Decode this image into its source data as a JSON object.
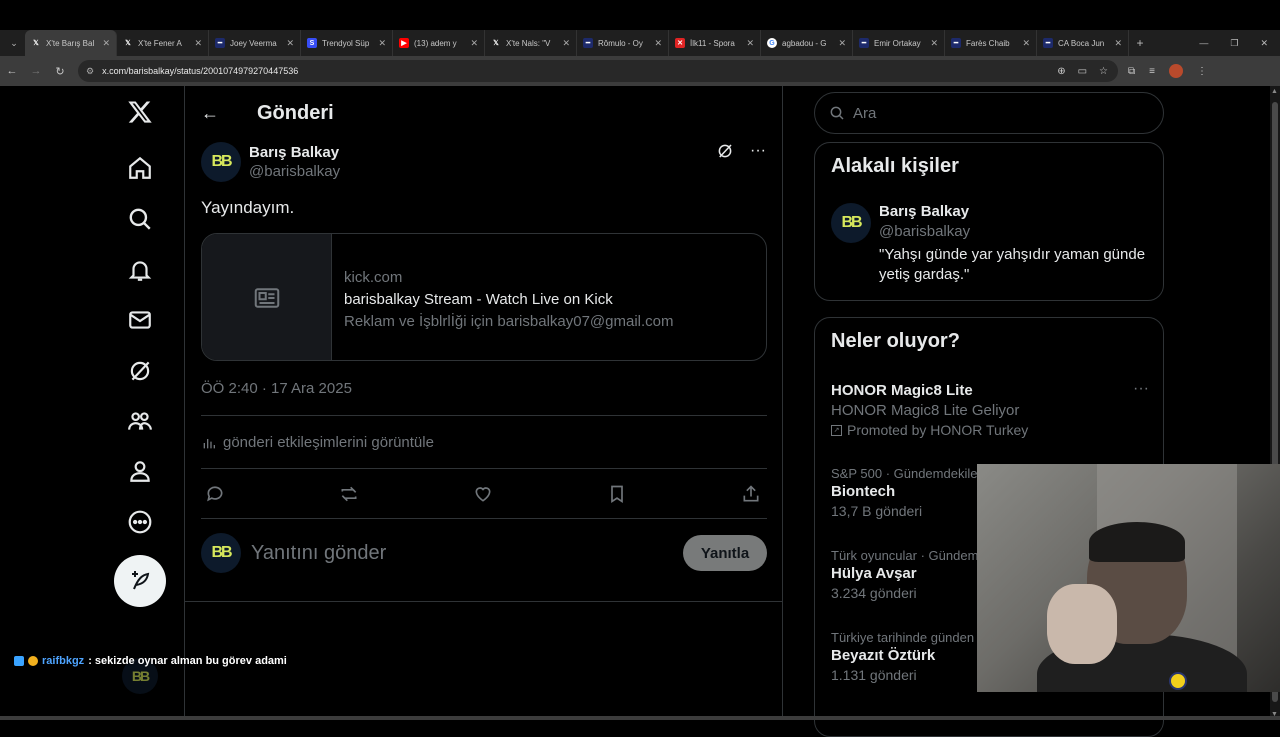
{
  "browser": {
    "tabs": [
      {
        "title": "X'te Barış Bal",
        "favicon": "x",
        "active": true
      },
      {
        "title": "X'te Fener A",
        "favicon": "x",
        "active": false
      },
      {
        "title": "Joey Veerma",
        "favicon": "fm",
        "active": false
      },
      {
        "title": "Trendyol Süp",
        "favicon": "sofa",
        "active": false
      },
      {
        "title": "(13) adem y",
        "favicon": "yt",
        "active": false
      },
      {
        "title": "X'te Nals: \"V",
        "favicon": "x",
        "active": false
      },
      {
        "title": "Rômulo - Oy",
        "favicon": "fm",
        "active": false
      },
      {
        "title": "İlk11 - Spora",
        "favicon": "ilk11",
        "active": false
      },
      {
        "title": "agbadou - G",
        "favicon": "google",
        "active": false
      },
      {
        "title": "Emir Ortakay",
        "favicon": "fm",
        "active": false
      },
      {
        "title": "Farès Chaib",
        "favicon": "fm",
        "active": false
      },
      {
        "title": "CA Boca Jun",
        "favicon": "fm",
        "active": false
      }
    ],
    "url": "x.com/barisbalkay/status/2001074979270447536"
  },
  "nav": {
    "items": [
      "x-logo-icon",
      "home-icon",
      "search-icon",
      "notifications-icon",
      "messages-icon",
      "grok-icon",
      "communities-icon",
      "profile-icon",
      "more-icon"
    ]
  },
  "main": {
    "header_title": "Gönderi",
    "author": {
      "initials": "BB",
      "name": "Barış Balkay",
      "handle": "@barisbalkay"
    },
    "text": "Yayındayım.",
    "card": {
      "domain": "kick.com",
      "title": "barisbalkay Stream - Watch Live on Kick",
      "description": "Reklam ve İşblrlİği için barisbalkay07@gmail.com"
    },
    "timestamp": "ÖÖ 2:40 · 17 Ara 2025",
    "engagements": "gönderi etkileşimlerini görüntüle",
    "reply_placeholder": "Yanıtını gönder",
    "reply_button": "Yanıtla"
  },
  "right": {
    "search_placeholder": "Ara",
    "related_title": "Alakalı kişiler",
    "related": {
      "name": "Barış Balkay",
      "handle": "@barisbalkay",
      "bio": "\"Yahşı günde yar yahşıdır yaman günde yetiş gardaş.\""
    },
    "trends_title": "Neler oluyor?",
    "trends": [
      {
        "category": "",
        "name": "HONOR Magic8 Lite",
        "sub": "HONOR Magic8 Lite Geliyor",
        "promo": "Promoted by HONOR Turkey"
      },
      {
        "category": "S&P 500 · Gündemdekile",
        "name": "Biontech",
        "sub": "13,7 B gönderi"
      },
      {
        "category": "Türk oyuncular · Gündem",
        "name": "Hülya Avşar",
        "sub": "3.234 gönderi"
      },
      {
        "category": "Türkiye tarihinde günden",
        "name": "Beyazıt Öztürk",
        "sub": "1.131 gönderi"
      }
    ]
  },
  "chat": {
    "user": "raifbkgz",
    "message": ": sekizde oynar alman bu görev adami"
  },
  "colors": {
    "accent": "#1d9bf0",
    "muted": "#71767b",
    "border": "#2f3336",
    "brand_logo": "#d7e85c"
  }
}
